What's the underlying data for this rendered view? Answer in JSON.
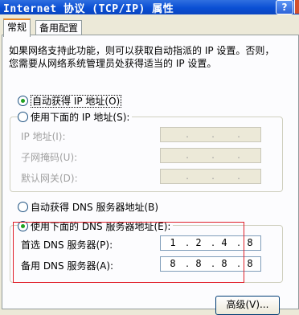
{
  "window": {
    "title": "Internet 协议 (TCP/IP) 属性",
    "help_label": "?"
  },
  "tabs": [
    {
      "label": "常规",
      "active": true
    },
    {
      "label": "备用配置",
      "active": false
    }
  ],
  "description": [
    "如果网络支持此功能，则可以获取自动指派的 IP 设置。否则，",
    "您需要从网络系统管理员处获得适当的 IP 设置。"
  ],
  "ip_section": {
    "auto_label": "自动获得 IP 地址(O)",
    "auto_checked": true,
    "manual_label": "使用下面的 IP 地址(S):",
    "manual_checked": false,
    "fields": [
      {
        "label": "IP 地址(I):",
        "octets": [
          "",
          "",
          "",
          ""
        ],
        "enabled": false
      },
      {
        "label": "子网掩码(U):",
        "octets": [
          "",
          "",
          "",
          ""
        ],
        "enabled": false
      },
      {
        "label": "默认网关(D):",
        "octets": [
          "",
          "",
          "",
          ""
        ],
        "enabled": false
      }
    ]
  },
  "dns_section": {
    "auto_label": "自动获得 DNS 服务器地址(B)",
    "auto_checked": false,
    "manual_label": "使用下面的 DNS 服务器地址(E):",
    "manual_checked": true,
    "fields": [
      {
        "label": "首选 DNS 服务器(P):",
        "octets": [
          "1",
          "2",
          "4",
          "8"
        ],
        "enabled": true
      },
      {
        "label": "备用 DNS 服务器(A):",
        "octets": [
          "8",
          "8",
          "8",
          "8"
        ],
        "enabled": true
      }
    ]
  },
  "buttons": {
    "advanced_label": "高级(V)..."
  },
  "colors": {
    "title_bar": "#0a4fd4",
    "dialog_bg": "#ece9d8",
    "highlight_box": "#e0212b",
    "radio_selected": "#21a121"
  }
}
